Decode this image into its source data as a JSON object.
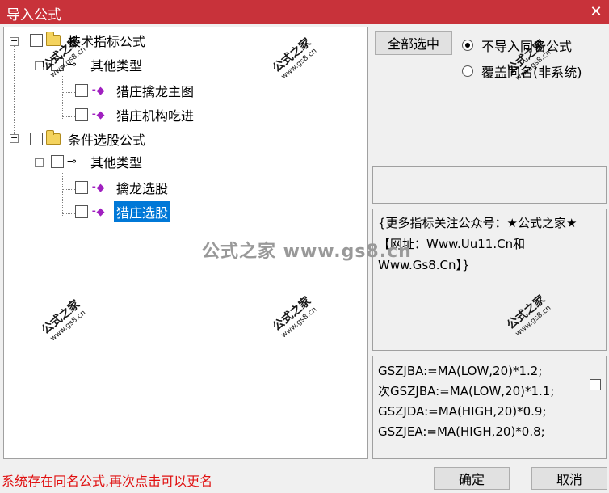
{
  "window": {
    "title": "导入公式",
    "close_glyph": "✕"
  },
  "tree": {
    "n0": "技术指标公式",
    "n1": "其他类型",
    "n2": "猎庄擒龙主图",
    "n3": "猎庄机构吃进",
    "n4": "条件选股公式",
    "n5": "其他类型",
    "n6": "擒龙选股",
    "n7": "猎庄选股"
  },
  "buttons": {
    "select_all": "全部选中",
    "ok": "确定",
    "cancel": "取消"
  },
  "options": {
    "no_import_same_name": "不导入同名公式",
    "overwrite_same_name": "覆盖同名(非系统)"
  },
  "description": "{更多指标关注公众号：★公式之家★【网址：Www.Uu11.Cn和Www.Gs8.Cn】}",
  "formula_lines": [
    "GSZJBA:=MA(LOW,20)*1.2;",
    "次GSZJBA:=MA(LOW,20)*1.1;",
    "GSZJDA:=MA(HIGH,20)*0.9;",
    "GSZJEA:=MA(HIGH,20)*0.8;"
  ],
  "status": "系统存在同名公式,再次点击可以更名",
  "watermark": {
    "main": "公式之家",
    "site": "www.gs8.cn",
    "center": "公式之家 www.gs8.cn"
  },
  "colors": {
    "titlebar": "#c8323a",
    "selection": "#0078d7",
    "status": "#e01010"
  }
}
